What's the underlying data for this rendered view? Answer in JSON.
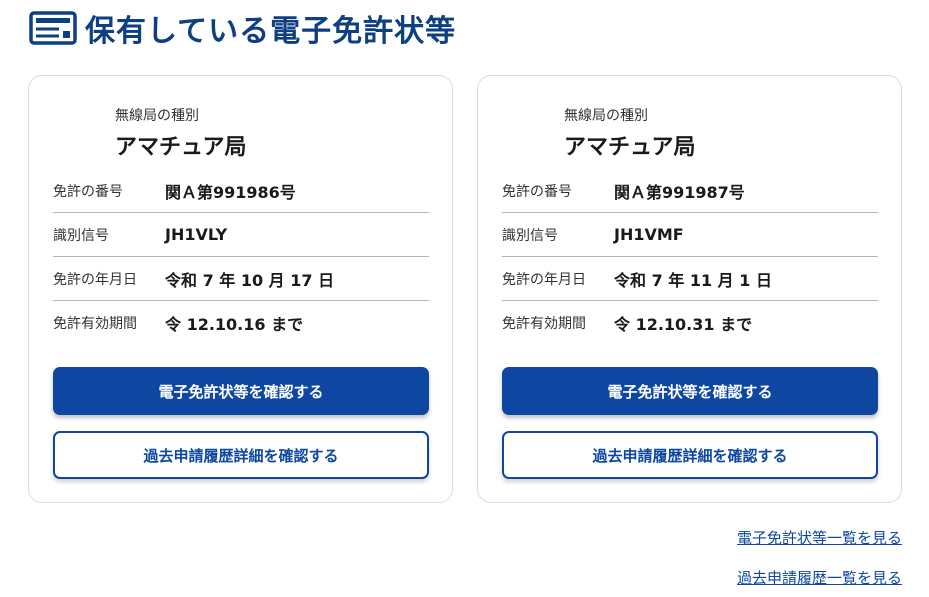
{
  "header": {
    "title": "保有している電子免許状等",
    "icon": "license-card-icon"
  },
  "colors": {
    "primary": "#0d47a1",
    "heading": "#0d3f82",
    "border": "#dcdcdc"
  },
  "cards": [
    {
      "type_label": "無線局の種別",
      "type_value": "アマチュア局",
      "rows": [
        {
          "label": "免許の番号",
          "value": "関Ａ第991986号"
        },
        {
          "label": "識別信号",
          "value": "JH1VLY"
        },
        {
          "label": "免許の年月日",
          "value": "令和 7 年 10 月 17 日"
        },
        {
          "label": "免許有効期間",
          "value": "令 12.10.16 まで"
        }
      ],
      "primary_button": "電子免許状等を確認する",
      "secondary_button": "過去申請履歴詳細を確認する"
    },
    {
      "type_label": "無線局の種別",
      "type_value": "アマチュア局",
      "rows": [
        {
          "label": "免許の番号",
          "value": "関Ａ第991987号"
        },
        {
          "label": "識別信号",
          "value": "JH1VMF"
        },
        {
          "label": "免許の年月日",
          "value": "令和 7 年 11 月 1 日"
        },
        {
          "label": "免許有効期間",
          "value": "令 12.10.31 まで"
        }
      ],
      "primary_button": "電子免許状等を確認する",
      "secondary_button": "過去申請履歴詳細を確認する"
    }
  ],
  "links": {
    "license_list": "電子免許状等一覧を見る",
    "history_list": "過去申請履歴一覧を見る"
  }
}
